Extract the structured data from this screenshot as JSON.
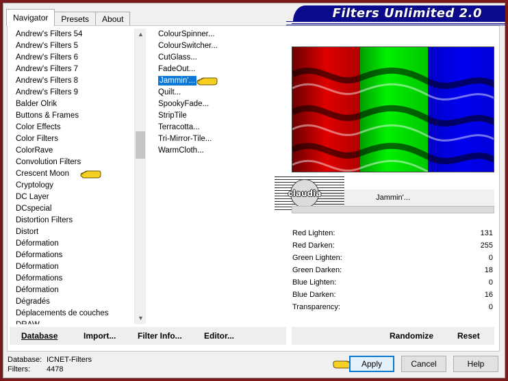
{
  "window_title": "Filters Unlimited 2.0",
  "tabs": [
    {
      "label": "Navigator",
      "active": true
    },
    {
      "label": "Presets",
      "active": false
    },
    {
      "label": "About",
      "active": false
    }
  ],
  "categories": [
    "Andrew's Filters 54",
    "Andrew's Filters 5",
    "Andrew's Filters 6",
    "Andrew's Filters 7",
    "Andrew's Filters 8",
    "Andrew's Filters 9",
    "Balder Olrik",
    "Buttons & Frames",
    "Color Effects",
    "Color Filters",
    "ColorRave",
    "Convolution Filters",
    "Crescent Moon",
    "Cryptology",
    "DC Layer",
    "DCspecial",
    "Distortion Filters",
    "Distort",
    "Déformation",
    "Déformations",
    "Déformation",
    "Déformations",
    "Déformation",
    "Dégradés",
    "Déplacements de couches",
    "DRAW"
  ],
  "highlighted_category": "Crescent Moon",
  "filters": [
    "ColourSpinner...",
    "ColourSwitcher...",
    "CutGlass...",
    "FadeOut...",
    "Jammin'...",
    "Quilt...",
    "SpookyFade...",
    "StripTile",
    "Terracotta...",
    "Tri-Mirror-Tile...",
    "WarmCloth..."
  ],
  "selected_filter": "Jammin'...",
  "current_filter_label": "Jammin'...",
  "watermark_text": "claudia",
  "parameters": [
    {
      "label": "Red Lighten:",
      "value": "131"
    },
    {
      "label": "Red Darken:",
      "value": "255"
    },
    {
      "label": "Green Lighten:",
      "value": "0"
    },
    {
      "label": "Green Darken:",
      "value": "18"
    },
    {
      "label": "Blue Lighten:",
      "value": "0"
    },
    {
      "label": "Blue Darken:",
      "value": "16"
    },
    {
      "label": "Transparency:",
      "value": "0"
    }
  ],
  "bottom_links": {
    "database": "Database",
    "import": "Import...",
    "filter_info": "Filter Info...",
    "editor": "Editor...",
    "randomize": "Randomize",
    "reset": "Reset"
  },
  "status": {
    "database_label": "Database:",
    "database_value": "ICNET-Filters",
    "filters_label": "Filters:",
    "filters_value": "4478"
  },
  "buttons": {
    "apply": "Apply",
    "cancel": "Cancel",
    "help": "Help"
  },
  "colors": {
    "banner": "#0a0a8c",
    "selection": "#0b78d7",
    "preview_red": "#e00000",
    "preview_green": "#00e000",
    "preview_blue": "#0000e0",
    "pointer_hand": "#f5d020"
  }
}
